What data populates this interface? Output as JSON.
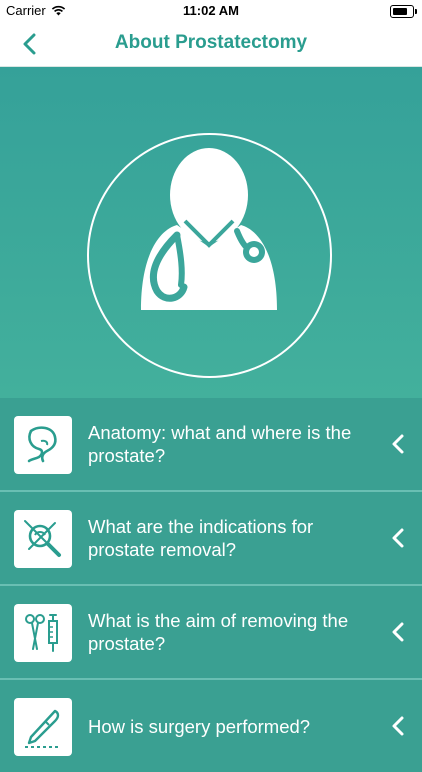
{
  "status_bar": {
    "carrier": "Carrier",
    "time": "11:02 AM"
  },
  "nav": {
    "title": "About Prostatectomy",
    "back_icon": "chevron-left-icon"
  },
  "colors": {
    "accent": "#2a9d8f",
    "hero_top": "#35a199",
    "hero_bottom": "#43b09c",
    "list_bg": "#3aa092"
  },
  "hero": {
    "icon": "doctor-icon"
  },
  "topics": [
    {
      "label": "Anatomy: what and where is the prostate?",
      "icon": "prostate-anatomy-icon"
    },
    {
      "label": "What are the indications for prostate removal?",
      "icon": "magnifier-inspection-icon"
    },
    {
      "label": "What is the aim of removing the prostate?",
      "icon": "surgical-instruments-icon"
    },
    {
      "label": "How is surgery performed?",
      "icon": "scalpel-icon"
    }
  ]
}
